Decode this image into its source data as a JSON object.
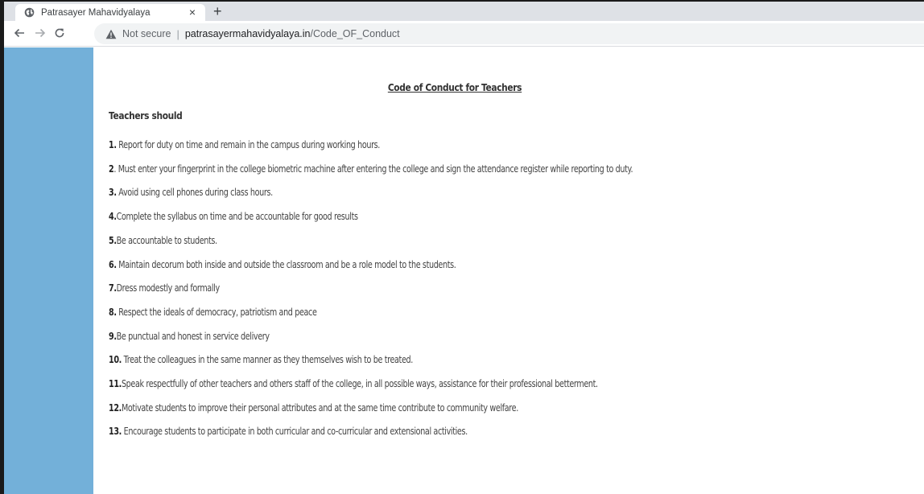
{
  "browser": {
    "tab_title": "Patrasayer Mahavidyalaya",
    "tab_close": "×",
    "new_tab": "+",
    "security_label": "Not secure",
    "separator": "|",
    "url_domain": "patrasayermahavidyalaya.in",
    "url_path": "/Code_OF_Conduct",
    "icons": {
      "favicon": "globe-icon",
      "back": "arrow-left-icon",
      "forward": "arrow-right-icon",
      "reload": "reload-icon",
      "security": "warning-triangle-icon"
    }
  },
  "page": {
    "sidebar_color": "#73b0d9",
    "heading": "Code of Conduct for Teachers",
    "subheading": "Teachers should",
    "rules": [
      {
        "num": "1.",
        "text": " Report for duty on time and remain in the campus during working hours."
      },
      {
        "num": "2",
        "text": ". Must enter your fingerprint in the college biometric machine after entering the college and sign the attendance register while reporting to duty."
      },
      {
        "num": "3.",
        "text": " Avoid using cell phones during class hours."
      },
      {
        "num": "4.",
        "text": "Complete the syllabus on time and be accountable for good results"
      },
      {
        "num": "5.",
        "text": "Be accountable to students."
      },
      {
        "num": "6.",
        "text": " Maintain decorum both inside and outside the classroom and be a role model to the students."
      },
      {
        "num": "7.",
        "text": "Dress modestly and formally"
      },
      {
        "num": "8.",
        "text": " Respect the ideals of democracy, patriotism and peace"
      },
      {
        "num": "9.",
        "text": "Be punctual and honest in service delivery"
      },
      {
        "num": "10.",
        "text": " Treat the colleagues in the same manner as they themselves wish to be treated."
      },
      {
        "num": "11.",
        "text": "Speak respectfully of other teachers and others staff of the college, in all possible ways, assistance for their professional betterment."
      },
      {
        "num": "12.",
        "text": "Motivate students to improve their personal attributes and at the same time contribute to community welfare."
      },
      {
        "num": "13.",
        "text": " Encourage students to participate in both curricular and co-curricular and extensional activities."
      }
    ]
  }
}
